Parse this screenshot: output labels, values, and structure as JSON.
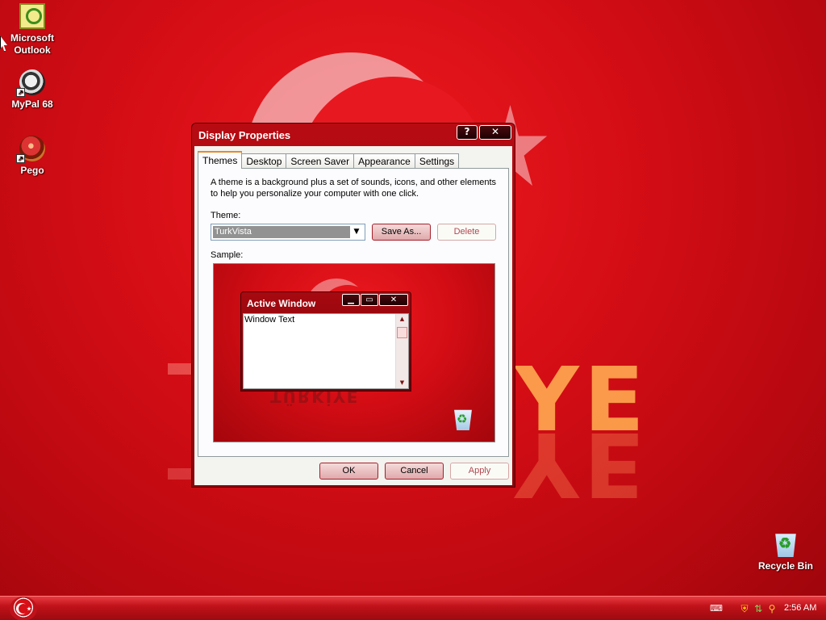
{
  "desktop": {
    "wallpaper_word": "TÜRKİYE",
    "icons": [
      {
        "label_line1": "Microsoft",
        "label_line2": "Outlook"
      },
      {
        "label": "MyPal 68"
      },
      {
        "label": "Pego"
      },
      {
        "label": "Recycle Bin"
      }
    ]
  },
  "dialog": {
    "title": "Display Properties",
    "help_btn": "?",
    "close_btn": "✕",
    "tabs": [
      {
        "label": "Themes",
        "active": true
      },
      {
        "label": "Desktop"
      },
      {
        "label": "Screen Saver"
      },
      {
        "label": "Appearance"
      },
      {
        "label": "Settings"
      }
    ],
    "description": "A theme is a background plus a set of sounds, icons, and other elements to help you personalize your computer with one click.",
    "theme_label": "Theme:",
    "theme_value": "TurkVista",
    "save_as_label": "Save As...",
    "delete_label": "Delete",
    "sample_label": "Sample:",
    "sample": {
      "window_title": "Active Window",
      "window_text": "Window Text",
      "min_btn": "▁",
      "max_btn": "▭",
      "close_btn": "✕"
    },
    "ok_label": "OK",
    "cancel_label": "Cancel",
    "apply_label": "Apply"
  },
  "taskbar": {
    "clock": "2:56 AM"
  },
  "colors": {
    "desktop": "#d50d15",
    "title_bar": "#b70b12",
    "dialog_face": "#f3f3ef",
    "button": "#dfa9ab"
  }
}
